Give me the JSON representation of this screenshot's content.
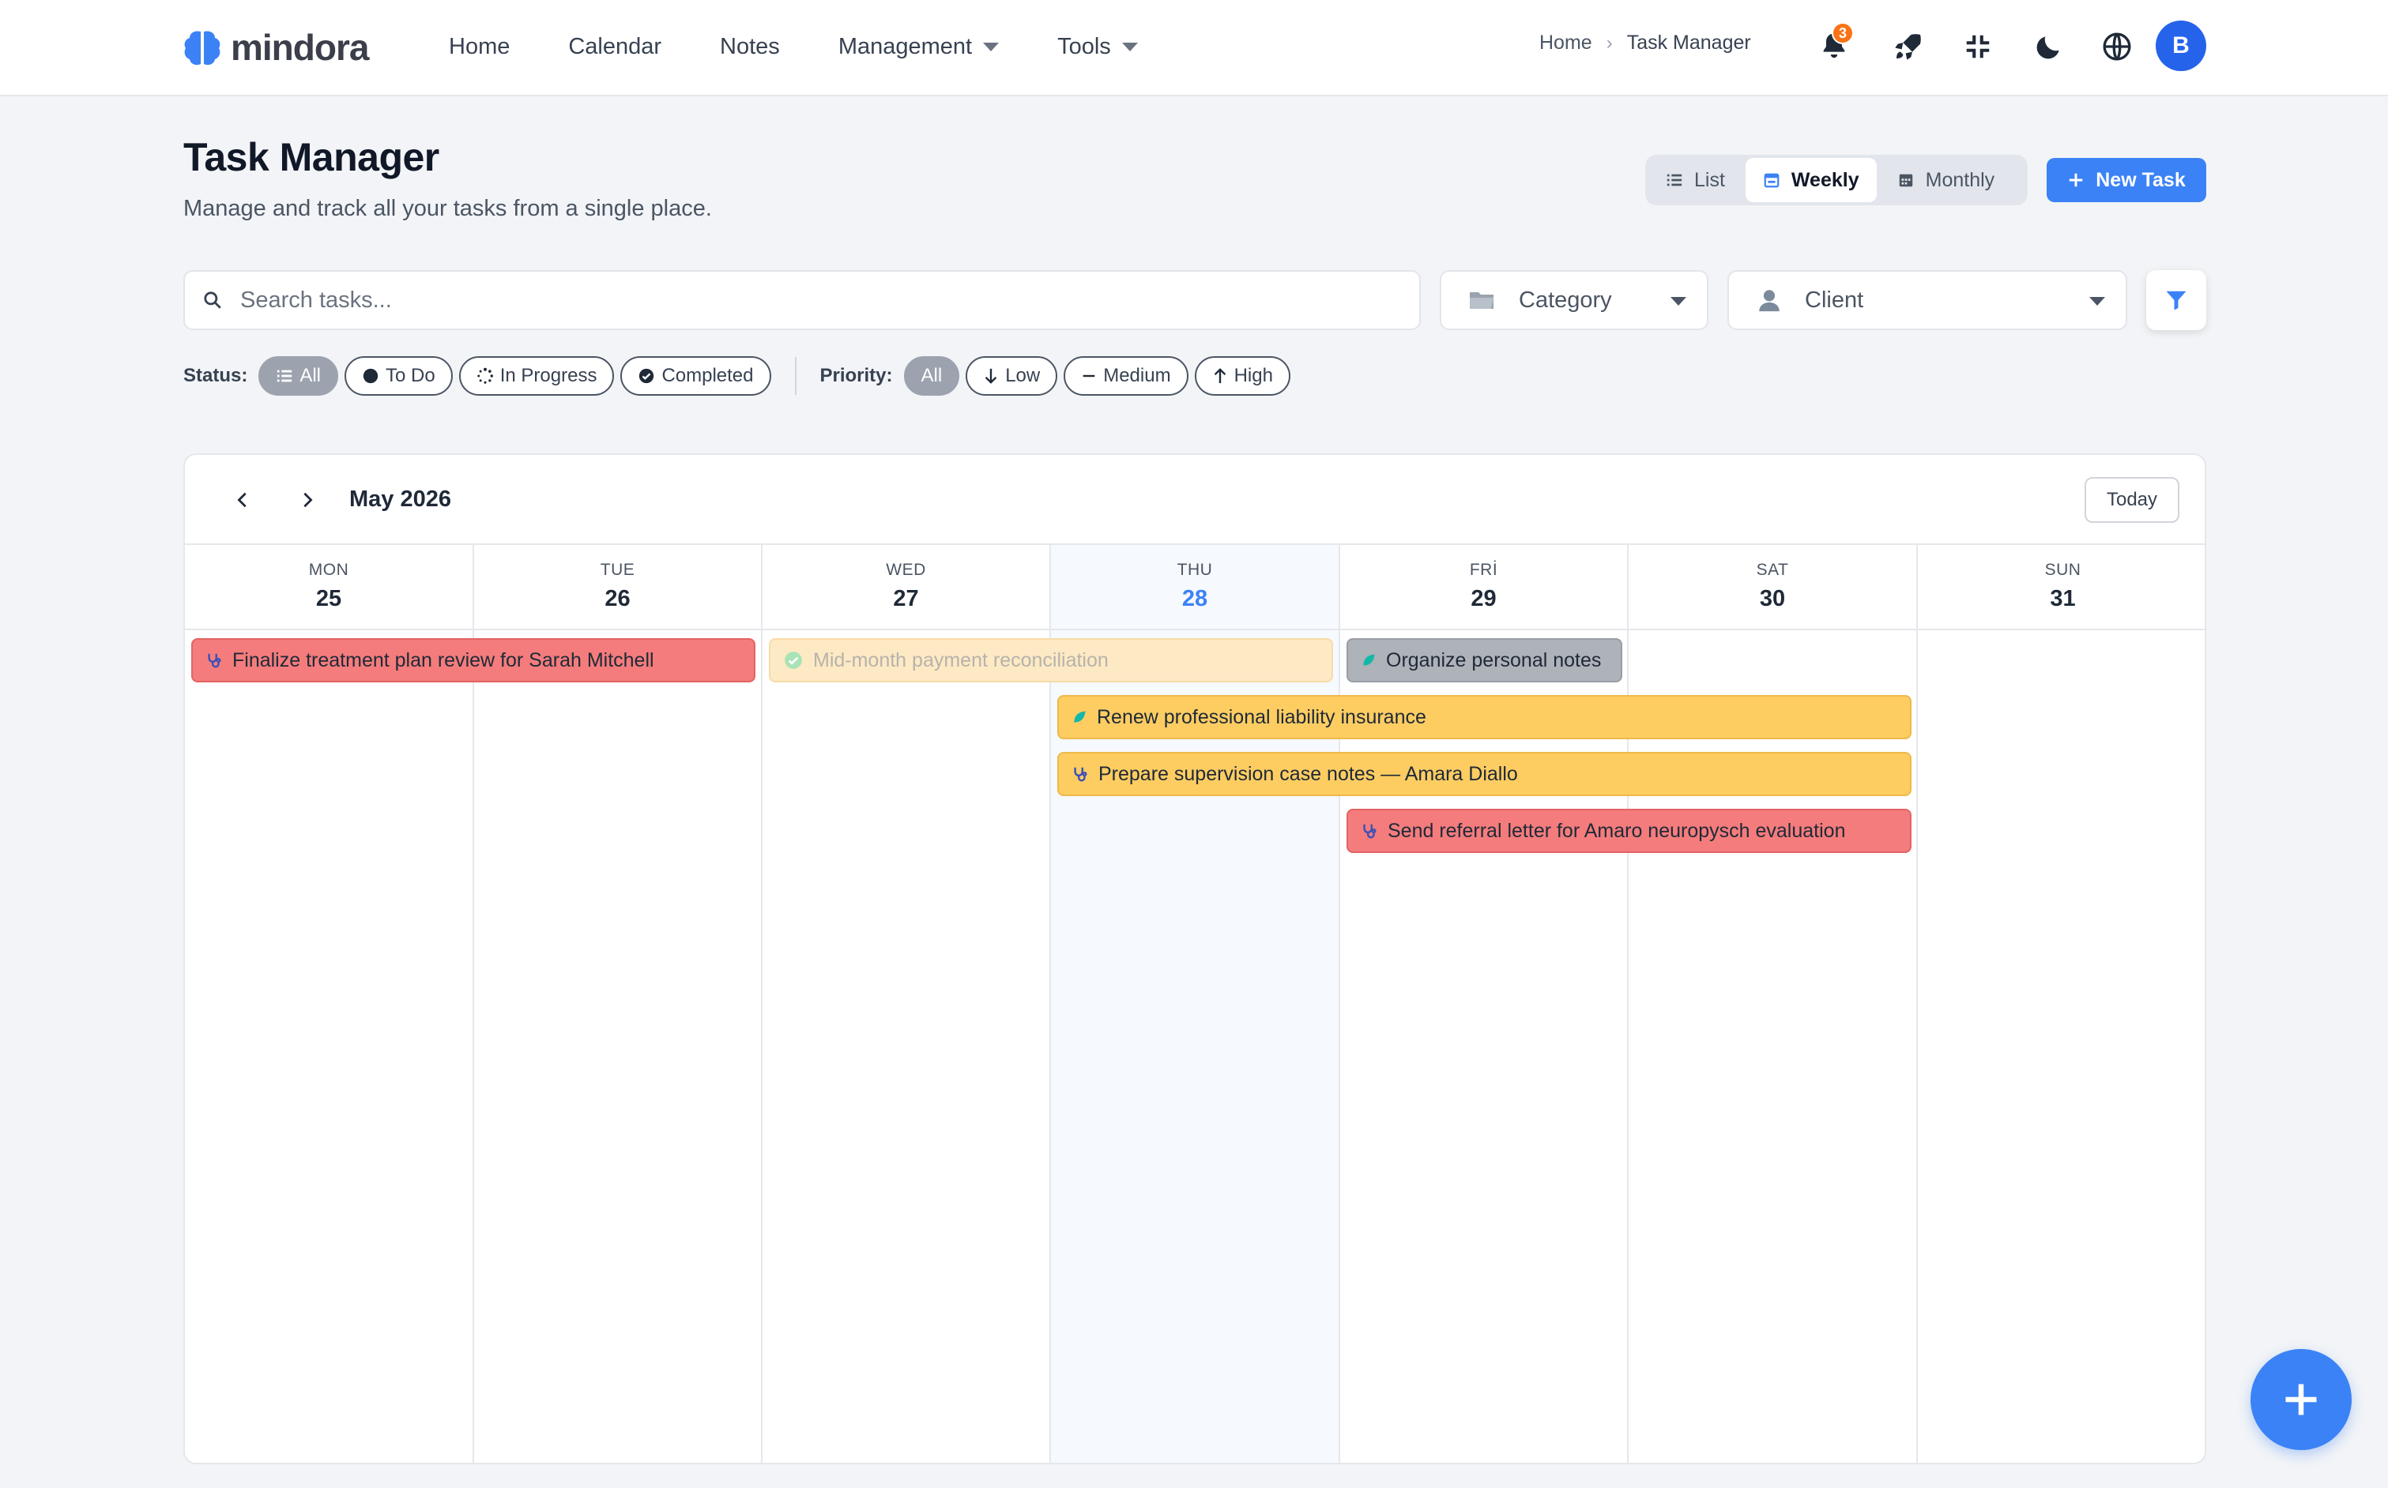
{
  "brand": {
    "name": "mindora"
  },
  "nav": {
    "items": [
      {
        "label": "Home"
      },
      {
        "label": "Calendar"
      },
      {
        "label": "Notes"
      },
      {
        "label": "Management",
        "dropdown": true
      },
      {
        "label": "Tools",
        "dropdown": true
      }
    ],
    "breadcrumb": {
      "home": "Home",
      "current": "Task Manager"
    },
    "notification_count": "3",
    "avatar_initial": "B",
    "icons": [
      "bell-icon",
      "rocket-icon",
      "compress-icon",
      "moon-icon",
      "globe-icon"
    ]
  },
  "header": {
    "title": "Task Manager",
    "subtitle": "Manage and track all your tasks from a single place.",
    "views": [
      {
        "label": "List",
        "icon": "list-icon",
        "active": false
      },
      {
        "label": "Weekly",
        "icon": "calendar-week-icon",
        "active": true
      },
      {
        "label": "Monthly",
        "icon": "calendar-month-icon",
        "active": false
      }
    ],
    "new_task_label": "New Task"
  },
  "filters": {
    "search_placeholder": "Search tasks...",
    "category_label": "Category",
    "client_label": "Client",
    "status_label": "Status:",
    "status_chips": [
      {
        "label": "All",
        "active": true
      },
      {
        "label": "To Do",
        "active": false
      },
      {
        "label": "In Progress",
        "active": false
      },
      {
        "label": "Completed",
        "active": false
      }
    ],
    "priority_label": "Priority:",
    "priority_chips": [
      {
        "label": "All",
        "active": true
      },
      {
        "label": "Low",
        "active": false
      },
      {
        "label": "Medium",
        "active": false
      },
      {
        "label": "High",
        "active": false
      }
    ]
  },
  "calendar": {
    "month_label": "May 2026",
    "today_label": "Today",
    "days": [
      {
        "dow": "MON",
        "num": "25",
        "today": false
      },
      {
        "dow": "TUE",
        "num": "26",
        "today": false
      },
      {
        "dow": "WED",
        "num": "27",
        "today": false
      },
      {
        "dow": "THU",
        "num": "28",
        "today": true
      },
      {
        "dow": "FRİ",
        "num": "29",
        "today": false
      },
      {
        "dow": "SAT",
        "num": "30",
        "today": false
      },
      {
        "dow": "SUN",
        "num": "31",
        "today": false
      }
    ],
    "events": [
      {
        "title": "Finalize treatment plan review for Sarah Mitchell",
        "status": "high",
        "icon": "stethoscope-icon"
      },
      {
        "title": "Mid-month payment reconciliation",
        "status": "completed",
        "icon": "check-circle-icon"
      },
      {
        "title": "Organize personal notes",
        "status": "low",
        "icon": "leaf-icon"
      },
      {
        "title": "Renew professional liability insurance",
        "status": "medium",
        "icon": "leaf-icon"
      },
      {
        "title": "Prepare supervision case notes — Amara Diallo",
        "status": "medium",
        "icon": "stethoscope-icon"
      },
      {
        "title": "Send referral letter for Amaro neuropysch evaluation",
        "status": "high",
        "icon": "stethoscope-icon"
      }
    ]
  },
  "colors": {
    "accent": "#3b82f6",
    "high": "#f47c7c",
    "medium": "#fdcd62",
    "low": "#aeb2b9",
    "completed": "#fde9c4",
    "badge": "#f97316"
  }
}
